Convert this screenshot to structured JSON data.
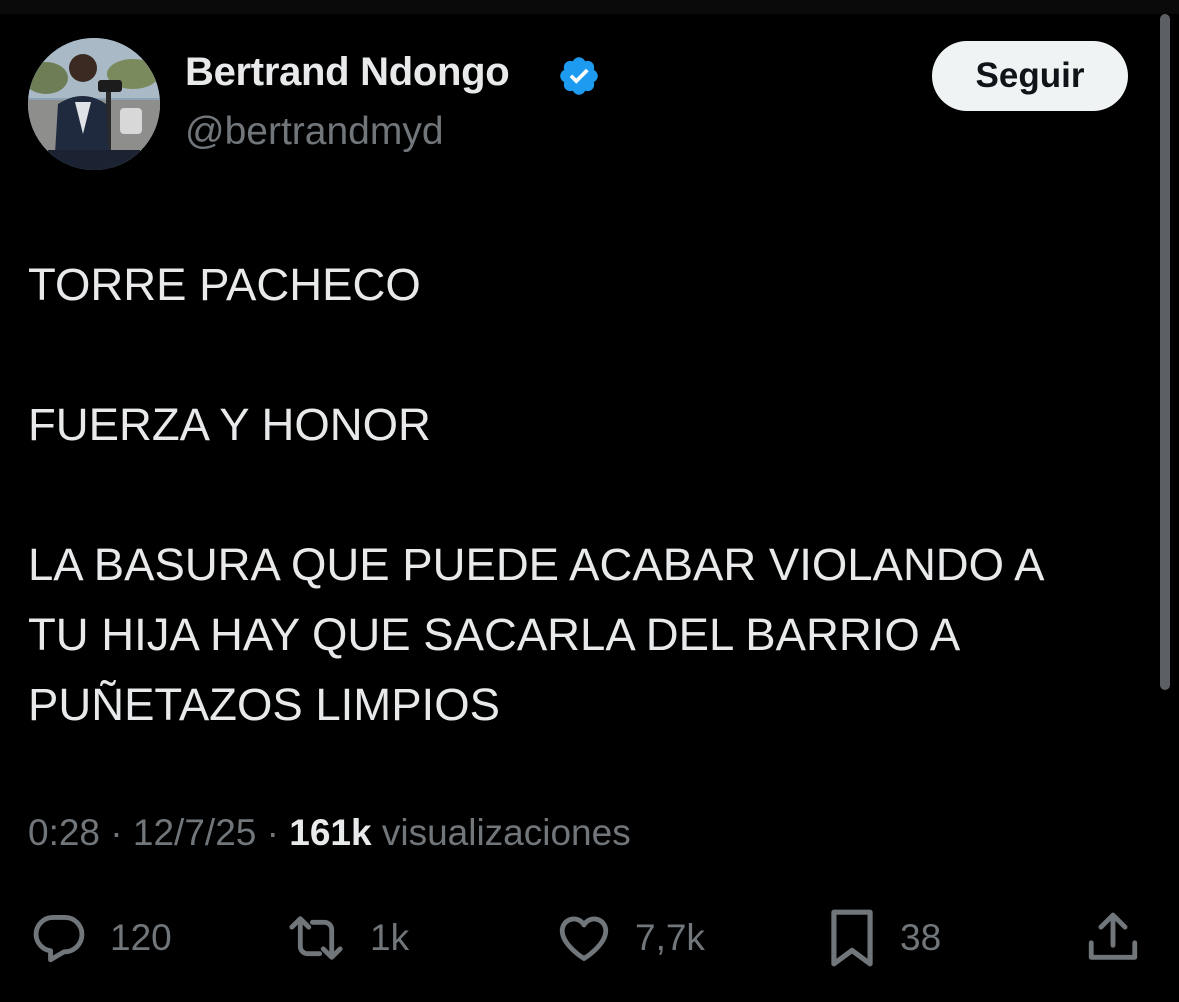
{
  "user": {
    "display_name": "Bertrand Ndongo",
    "handle": "@bertrandmyd",
    "verified": true
  },
  "follow_button": {
    "label": "Seguir"
  },
  "tweet": {
    "paragraphs": [
      "TORRE PACHECO",
      "FUERZA Y HONOR",
      "LA BASURA QUE PUEDE ACABAR VIOLANDO A",
      "TU HIJA HAY QUE SACARLA DEL BARRIO A",
      "PUÑETAZOS LIMPIOS"
    ]
  },
  "meta": {
    "time": "0:28",
    "date": "12/7/25",
    "separator": "·",
    "views_count": "161k",
    "views_label": "visualizaciones"
  },
  "actions": {
    "reply": {
      "icon": "reply-icon",
      "count": "120"
    },
    "retweet": {
      "icon": "retweet-icon",
      "count": "1k"
    },
    "like": {
      "icon": "heart-icon",
      "count": "7,7k"
    },
    "bookmark": {
      "icon": "bookmark-icon",
      "count": "38"
    },
    "share": {
      "icon": "share-icon"
    }
  },
  "colors": {
    "background": "#000000",
    "primary_text": "#e7e9ea",
    "secondary_text": "#71767b",
    "verified_badge": "#1d9bf0",
    "follow_button_bg": "#eff3f4",
    "follow_button_text": "#0f1419"
  }
}
